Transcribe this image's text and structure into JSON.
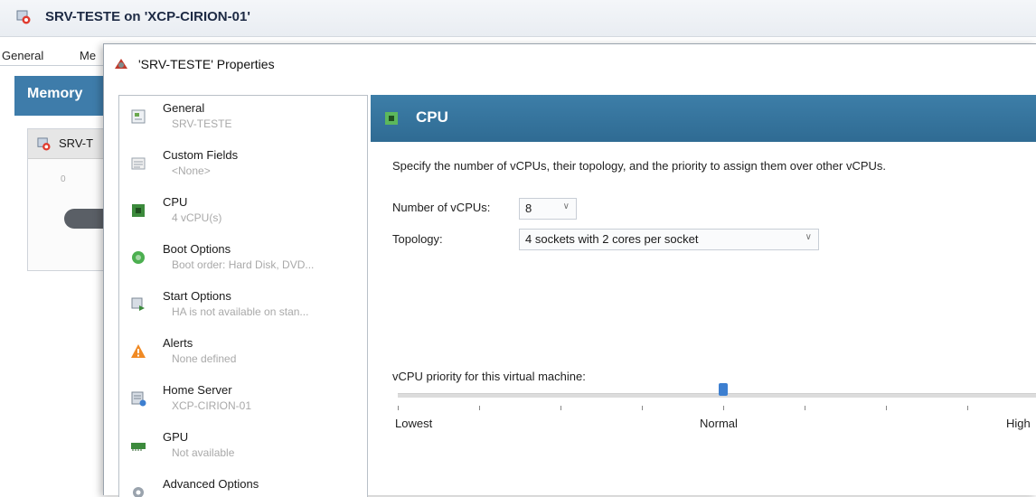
{
  "main_window": {
    "title": "SRV-TESTE on 'XCP-CIRION-01'",
    "tabs": [
      "General",
      "Me"
    ],
    "memory_header": "Memory",
    "memory_card_label": "SRV-T",
    "memory_scale_zero": "0"
  },
  "dialog": {
    "title": "'SRV-TESTE' Properties",
    "nav": [
      {
        "label": "General",
        "sub": "SRV-TESTE",
        "icon": "general-icon"
      },
      {
        "label": "Custom Fields",
        "sub": "<None>",
        "icon": "custom-fields-icon"
      },
      {
        "label": "CPU",
        "sub": "4 vCPU(s)",
        "icon": "cpu-icon"
      },
      {
        "label": "Boot Options",
        "sub": "Boot order: Hard Disk, DVD...",
        "icon": "boot-options-icon"
      },
      {
        "label": "Start Options",
        "sub": "HA is not available on stan...",
        "icon": "start-options-icon"
      },
      {
        "label": "Alerts",
        "sub": "None defined",
        "icon": "alert-icon"
      },
      {
        "label": "Home Server",
        "sub": "XCP-CIRION-01",
        "icon": "home-server-icon"
      },
      {
        "label": "GPU",
        "sub": "Not available",
        "icon": "gpu-icon"
      },
      {
        "label": "Advanced Options",
        "sub": "",
        "icon": "advanced-options-icon"
      }
    ],
    "selected_nav": "CPU",
    "cpu": {
      "header": "CPU",
      "description": "Specify the number of vCPUs, their topology, and the priority to assign them over other vCPUs.",
      "vcpus_label": "Number of vCPUs:",
      "vcpus_value": "8",
      "topology_label": "Topology:",
      "topology_value": "4 sockets with 2 cores per socket",
      "priority_label": "vCPU priority for this virtual machine:",
      "priority_low": "Lowest",
      "priority_mid": "Normal",
      "priority_high": "High",
      "priority_level_fraction": 0.5
    }
  },
  "colors": {
    "header_blue": "#3d7ea8",
    "slider_thumb": "#3d7fd0",
    "muted_text": "#a9a9a9"
  }
}
